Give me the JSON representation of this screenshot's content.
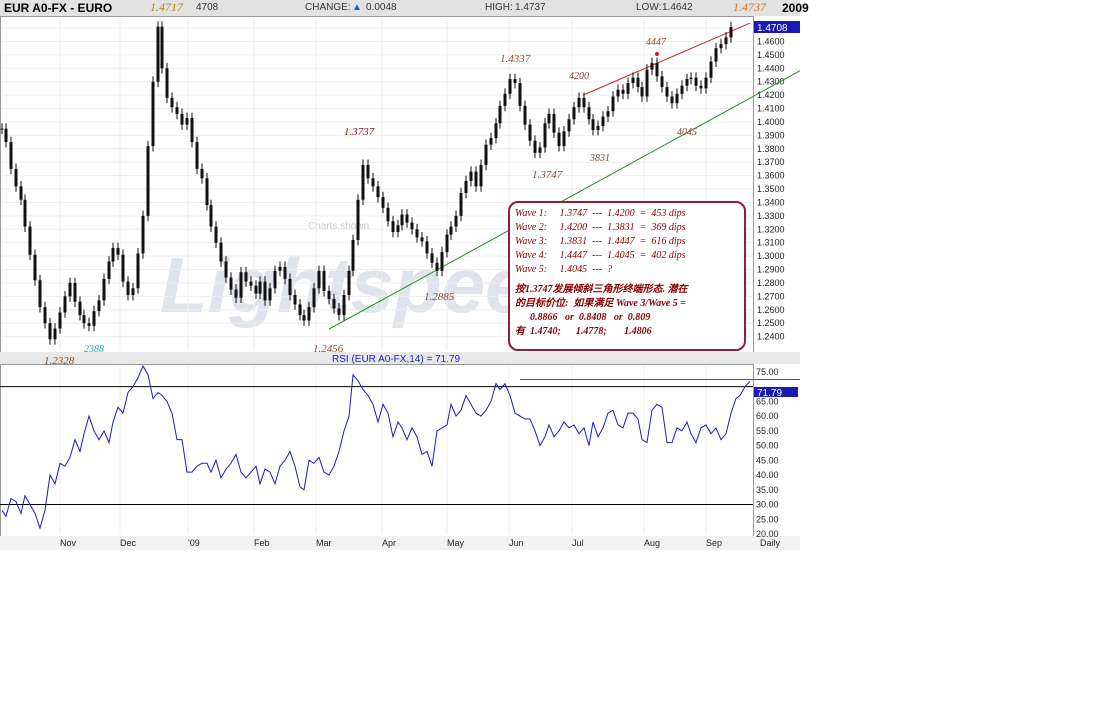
{
  "header": {
    "symbol": "EUR A0-FX - EURO",
    "last": "4708",
    "change_label": "CHANGE:",
    "change_value": "0.0048",
    "high_label": "HIGH:",
    "high_value": "1.4737",
    "low_label": "LOW:",
    "low_value": "1.4642",
    "year": "2009",
    "left_high": "1.4717",
    "right_high": "1.4737"
  },
  "colors": {
    "candle": "#111111",
    "rsi_line": "#1a1acc",
    "trend_green": "#1f8f1f",
    "trend_red": "#cc2222",
    "annotation": "#8b4a2a",
    "wave_text": "#8b0000",
    "price_tag_bg": "#1a1ab0"
  },
  "annotations": {
    "price_high_left": "1.4717",
    "p13737": "1.3737",
    "p12885": "1.2885",
    "p12456": "1.2456",
    "p12328": "1.2328",
    "p2388": "2388",
    "p14337": "1.4337",
    "p13747": "1.3747",
    "p4200": "4200",
    "p4447": "4447",
    "p3831": "3831",
    "p4045": "4045",
    "watermark_small": "Charts shown"
  },
  "wave_box": {
    "lines": [
      "Wave 1:     1.3747  ---  1.4200  =  453 dips",
      "Wave 2:     1.4200  ---  1.3831  =  369 dips",
      "Wave 3:     1.3831  ---  1.4447  =  616 dips",
      "Wave 4:     1.4447  ---  1.4045  =  402 dips",
      "Wave 5:     1.4045  ---  ?"
    ],
    "note1": "按1.3747发展倾斜三角形终端形态. 潜在",
    "note2": "的目标价位:  如果满足 Wave 3/Wave 5 =",
    "note3": "      0.8866   or  0.8408   or  0.809",
    "note4": "有  1.4740;      1.4778;       1.4806"
  },
  "chart_data": {
    "type": "line",
    "title": "EUR A0-FX - EURO",
    "subtitle": "Daily",
    "price_axis": {
      "ticks": [
        "1.4700",
        "1.4600",
        "1.4500",
        "1.4400",
        "1.4300",
        "1.4200",
        "1.4100",
        "1.4000",
        "1.3900",
        "1.3800",
        "1.3700",
        "1.3600",
        "1.3500",
        "1.3400",
        "1.3300",
        "1.3200",
        "1.3100",
        "1.3000",
        "1.2900",
        "1.2800",
        "1.2700",
        "1.2600",
        "1.2500",
        "1.2400"
      ],
      "ylim": [
        1.23,
        1.4775
      ],
      "last_price_tag": "1.4708"
    },
    "x_labels": [
      "Nov",
      "Dec",
      "'09",
      "Feb",
      "Mar",
      "Apr",
      "May",
      "Jun",
      "Jul",
      "Aug",
      "Sep",
      "Daily"
    ],
    "price_series": {
      "name": "EUR A0-FX",
      "x": [
        0,
        4,
        9,
        14,
        19,
        23,
        28,
        33,
        38,
        43,
        48,
        53,
        58,
        63,
        68,
        73,
        78,
        82,
        87,
        92,
        97,
        102,
        107,
        111,
        116,
        121,
        126,
        131,
        136,
        141,
        146,
        151,
        156,
        160,
        165,
        170,
        175,
        180,
        185,
        190,
        195,
        200,
        205,
        209,
        214,
        219,
        224,
        229,
        234,
        239,
        244,
        249,
        254,
        258,
        263,
        268,
        273,
        278,
        283,
        288,
        293,
        298,
        302,
        307,
        312,
        317,
        322,
        327,
        332,
        337,
        342,
        347,
        351,
        356,
        361,
        366,
        371,
        376,
        381,
        386,
        391,
        396,
        400,
        405,
        410,
        415,
        420,
        425,
        430,
        435,
        440,
        445,
        449,
        454,
        459,
        464,
        469,
        474,
        479,
        484,
        489,
        494,
        498,
        503,
        508,
        513,
        518,
        523,
        528,
        533,
        538,
        543,
        547,
        552,
        557,
        562,
        567,
        572,
        577,
        582,
        587,
        591,
        596,
        601,
        606,
        611,
        616,
        621,
        626,
        631,
        636,
        640,
        645,
        650,
        655,
        660,
        665,
        670,
        675,
        680,
        685,
        689,
        694,
        699,
        704,
        709,
        714,
        719,
        724,
        729,
        734,
        738,
        743,
        748
      ],
      "close": [
        1.395,
        1.385,
        1.365,
        1.352,
        1.342,
        1.322,
        1.301,
        1.282,
        1.262,
        1.25,
        1.238,
        1.246,
        1.258,
        1.27,
        1.28,
        1.266,
        1.256,
        1.25,
        1.248,
        1.259,
        1.267,
        1.283,
        1.296,
        1.306,
        1.301,
        1.281,
        1.271,
        1.276,
        1.302,
        1.33,
        1.382,
        1.43,
        1.471,
        1.44,
        1.418,
        1.411,
        1.406,
        1.398,
        1.403,
        1.385,
        1.365,
        1.358,
        1.338,
        1.322,
        1.31,
        1.296,
        1.284,
        1.275,
        1.269,
        1.288,
        1.281,
        1.278,
        1.272,
        1.281,
        1.267,
        1.276,
        1.289,
        1.292,
        1.283,
        1.271,
        1.264,
        1.256,
        1.252,
        1.262,
        1.276,
        1.289,
        1.274,
        1.268,
        1.261,
        1.256,
        1.271,
        1.289,
        1.312,
        1.342,
        1.368,
        1.358,
        1.352,
        1.344,
        1.336,
        1.326,
        1.318,
        1.323,
        1.331,
        1.325,
        1.32,
        1.314,
        1.311,
        1.302,
        1.295,
        1.289,
        1.303,
        1.316,
        1.322,
        1.33,
        1.347,
        1.356,
        1.363,
        1.352,
        1.368,
        1.383,
        1.388,
        1.399,
        1.412,
        1.421,
        1.432,
        1.429,
        1.412,
        1.398,
        1.386,
        1.377,
        1.381,
        1.399,
        1.406,
        1.392,
        1.382,
        1.393,
        1.402,
        1.411,
        1.418,
        1.411,
        1.402,
        1.394,
        1.397,
        1.404,
        1.408,
        1.419,
        1.424,
        1.421,
        1.429,
        1.433,
        1.426,
        1.419,
        1.439,
        1.444,
        1.434,
        1.426,
        1.419,
        1.414,
        1.421,
        1.427,
        1.432,
        1.433,
        1.427,
        1.425,
        1.433,
        1.445,
        1.455,
        1.458,
        1.463,
        1.4708
      ]
    },
    "rsi": {
      "title": "RSI (EUR A0-FX,14) = 71.79",
      "ticks": [
        "75.00",
        "65.00",
        "60.00",
        "55.00",
        "50.00",
        "45.00",
        "40.00",
        "35.00",
        "30.00",
        "25.00",
        "20.00"
      ],
      "ylim": [
        20,
        77
      ],
      "current": "71.79",
      "reference_lines": [
        70,
        30
      ],
      "x": [
        0,
        4,
        9,
        14,
        19,
        23,
        28,
        33,
        38,
        43,
        48,
        53,
        58,
        63,
        68,
        73,
        78,
        82,
        87,
        92,
        97,
        102,
        107,
        111,
        116,
        121,
        126,
        131,
        136,
        141,
        146,
        151,
        156,
        160,
        165,
        170,
        175,
        180,
        185,
        190,
        195,
        200,
        205,
        209,
        214,
        219,
        224,
        229,
        234,
        239,
        244,
        249,
        254,
        258,
        263,
        268,
        273,
        278,
        283,
        288,
        293,
        298,
        302,
        307,
        312,
        317,
        322,
        327,
        332,
        337,
        342,
        347,
        351,
        356,
        361,
        366,
        371,
        376,
        381,
        386,
        391,
        396,
        400,
        405,
        410,
        415,
        420,
        425,
        430,
        435,
        440,
        445,
        449,
        454,
        459,
        464,
        469,
        474,
        479,
        484,
        489,
        494,
        498,
        503,
        508,
        513,
        518,
        523,
        528,
        533,
        538,
        543,
        547,
        552,
        557,
        562,
        567,
        572,
        577,
        582,
        587,
        591,
        596,
        601,
        606,
        611,
        616,
        621,
        626,
        631,
        636,
        640,
        645,
        650,
        655,
        660,
        665,
        670,
        675,
        680,
        685,
        689,
        694,
        699,
        704,
        709,
        714,
        719,
        724,
        729,
        734,
        738,
        743,
        748
      ],
      "values": [
        28,
        26,
        32,
        31,
        27,
        33,
        30,
        27,
        22,
        28,
        40,
        37,
        44,
        43,
        46,
        52,
        48,
        54,
        60,
        55,
        52,
        55,
        51,
        58,
        63,
        61,
        68,
        70,
        73,
        77,
        74,
        66,
        68,
        67,
        65,
        61,
        52,
        52,
        41,
        41,
        43,
        44,
        44,
        41,
        45,
        39,
        42,
        44,
        47,
        41,
        39,
        41,
        43,
        37,
        42,
        41,
        37,
        43,
        45,
        48,
        43,
        36,
        35,
        45,
        44,
        46,
        41,
        40,
        43,
        48,
        55,
        60,
        74,
        72,
        69,
        67,
        64,
        58,
        64,
        61,
        53,
        58,
        56,
        52,
        56,
        53,
        47,
        48,
        43,
        55,
        56,
        57,
        64,
        60,
        62,
        67,
        64,
        61,
        60,
        62,
        65,
        71,
        69,
        71,
        67,
        61,
        60,
        59,
        59,
        55,
        50,
        53,
        57,
        53,
        55,
        58,
        56,
        57,
        54,
        56,
        50,
        58,
        53,
        56,
        61,
        62,
        57,
        56,
        61,
        61,
        59,
        52,
        51,
        62,
        64,
        63,
        51,
        51,
        56,
        55,
        58,
        54,
        51,
        56,
        57,
        54,
        56,
        52,
        54,
        61,
        66,
        67,
        70,
        71.79
      ]
    },
    "trendlines": [
      {
        "name": "lower",
        "color": "green"
      },
      {
        "name": "upper",
        "color": "red"
      }
    ],
    "grid": true
  }
}
